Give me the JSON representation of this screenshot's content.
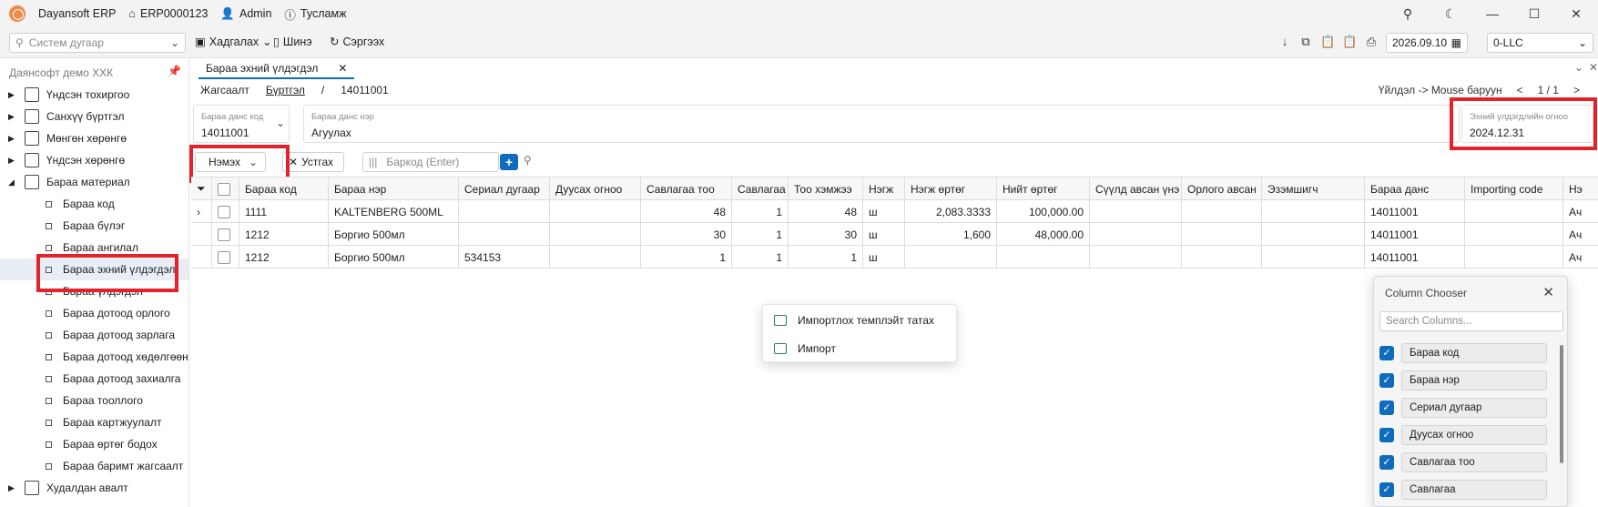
{
  "titlebar": {
    "app": "Dayansoft ERP",
    "code": "ERP0000123",
    "user": "Admin",
    "help": "Тусламж"
  },
  "toolbar": {
    "search_placeholder": "Систем дугаар",
    "save": "Хадгалах",
    "new": "Шинэ",
    "refresh": "Сэргээх",
    "date": "2026.09.10",
    "company_code": "0-LLC"
  },
  "sidebar": {
    "company": "Даянсофт демо ХХК",
    "top": [
      "Үндсэн тохиргоо",
      "Санхүү бүртгэл",
      "Мөнгөн хөрөнгө",
      "Үндсэн хөрөнгө",
      "Бараа материал"
    ],
    "children": [
      "Бараа код",
      "Бараа бүлэг",
      "Бараа ангилал",
      "Бараа эхний үлдэгдэл",
      "Бараа үлдэгдэл",
      "Бараа дотоод орлого",
      "Бараа дотоод зарлага",
      "Бараа дотоод хөдөлгөөн",
      "Бараа дотоод захиалга",
      "Бараа тооллого",
      "Бараа картжуулалт",
      "Бараа өртөг бодох",
      "Бараа баримт жагсаалт"
    ],
    "bottom": "Худалдан авалт"
  },
  "doc": {
    "tab": "Бараа эхний үлдэгдэл",
    "crumb": [
      "Жагсаалт",
      "Бүртгэл",
      "/",
      "14011001"
    ],
    "pager_hint": "Үйлдэл -> Mouse баруун",
    "pager": "1 / 1",
    "field_code_label": "Бараа данс код",
    "field_code": "14011001",
    "field_name_label": "Бараа данс нэр",
    "field_name": "Агуулах",
    "field_date_label": "Эхний үлдэгдлийн огноо",
    "field_date": "2024.12.31",
    "add": "Нэмэх",
    "delete": "Устгах",
    "barcode_placeholder": "Баркод (Enter)"
  },
  "grid": {
    "columns": [
      "Бараа код",
      "Бараа нэр",
      "Сериал дугаар",
      "Дуусах огноо",
      "Савлагаа тоо",
      "Савлагаа",
      "Тоо хэмжээ",
      "Нэгж",
      "Нэгж өртөг",
      "Нийт өртөг",
      "Сүүлд авсан үнэ",
      "Орлого авсан",
      "Эзэмшигч",
      "Бараа данс",
      "Importing code",
      "Нэ"
    ],
    "rows": [
      [
        "1111",
        "KALTENBERG 500ML",
        "",
        "",
        "48",
        "1",
        "48",
        "ш",
        "2,083.3333",
        "100,000.00",
        "",
        "",
        "",
        "14011001",
        "",
        "Ач"
      ],
      [
        "1212",
        "Боргио 500мл",
        "",
        "",
        "30",
        "1",
        "30",
        "ш",
        "1,600",
        "48,000.00",
        "",
        "",
        "",
        "14011001",
        "",
        "Ач"
      ],
      [
        "1212",
        "Боргио 500мл",
        "534153",
        "",
        "1",
        "1",
        "1",
        "ш",
        "",
        "",
        "",
        "",
        "",
        "14011001",
        "",
        "Ач"
      ]
    ]
  },
  "context_menu": [
    "Импортлох темплэйт татах",
    "Импорт"
  ],
  "column_chooser": {
    "title": "Column Chooser",
    "search_placeholder": "Search Columns...",
    "items": [
      "Бараа код",
      "Бараа нэр",
      "Сериал дугаар",
      "Дуусах огноо",
      "Савлагаа тоо",
      "Савлагаа"
    ]
  },
  "colors": {
    "accent": "#0f6cbd",
    "highlight": "#e3222b",
    "logo": "#f08a4b"
  }
}
